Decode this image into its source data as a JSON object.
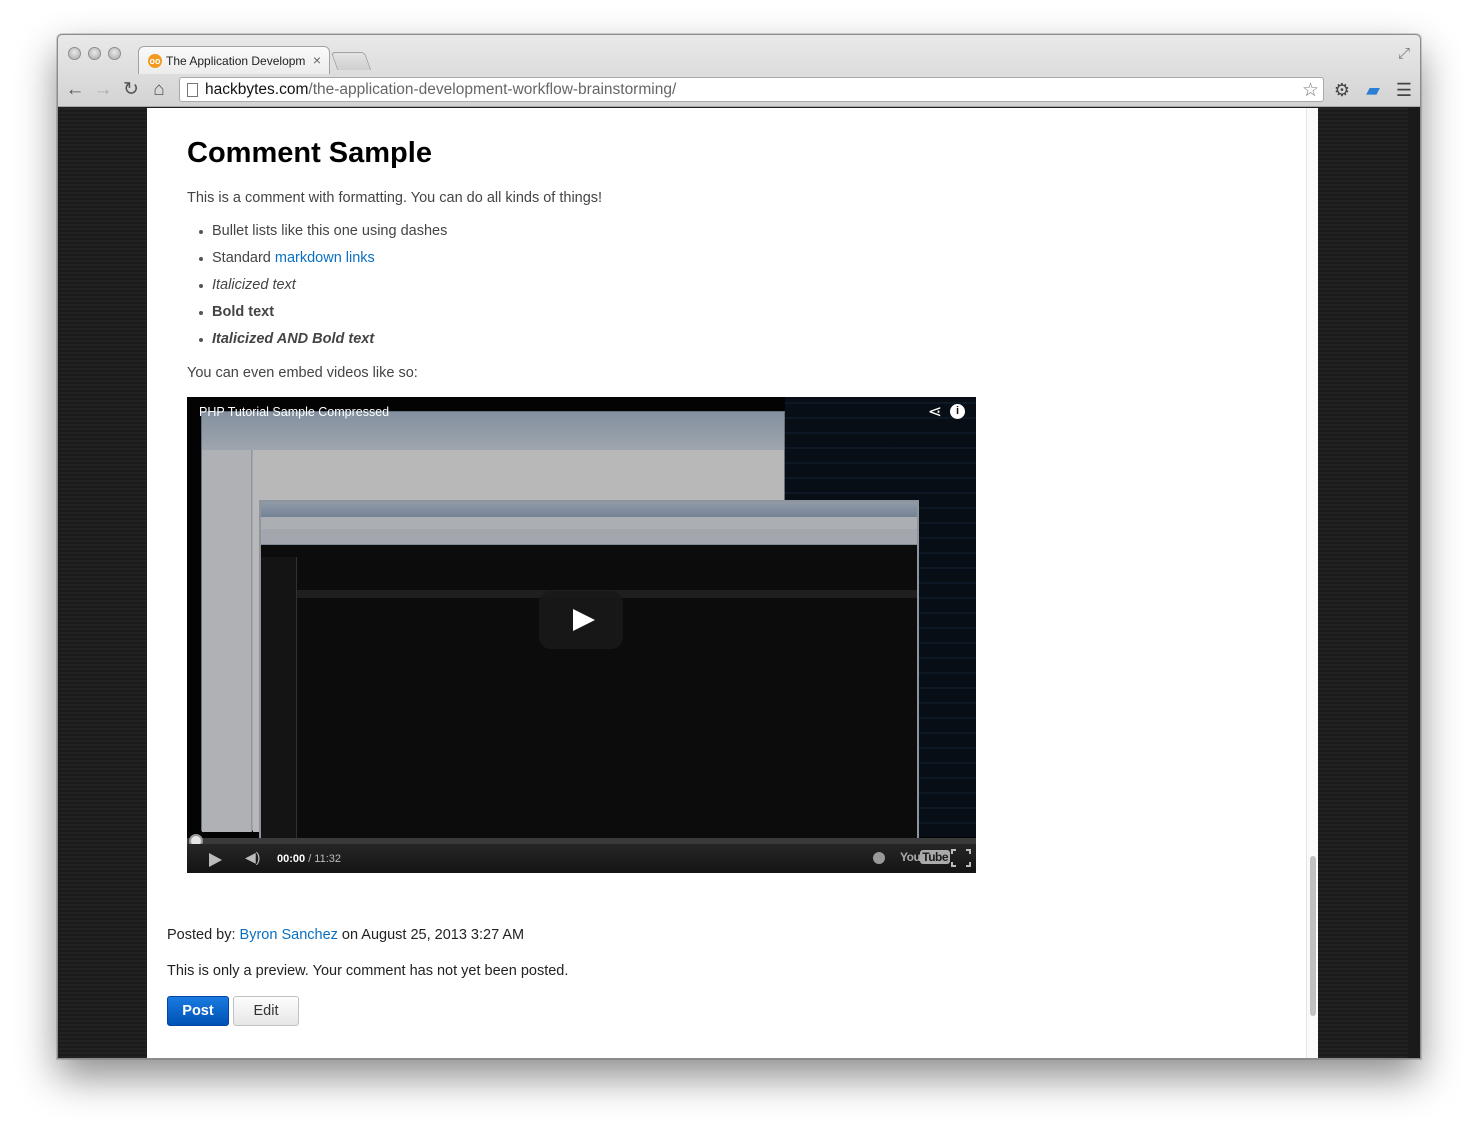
{
  "browser": {
    "tab_title": "The Application Developm",
    "tab_close": "×",
    "url_host": "hackbytes.com",
    "url_path": "/the-application-development-workflow-brainstorming/"
  },
  "comment": {
    "title": "Comment Sample",
    "intro": "This is a comment with formatting. You can do all kinds of things!",
    "list": {
      "item1": "Bullet lists like this one using dashes",
      "item2_prefix": "Standard ",
      "item2_link": "markdown links",
      "item3": "Italicized text",
      "item4": "Bold text",
      "item5": "Italicized AND Bold text"
    },
    "embed_text": "You can even embed videos like so:"
  },
  "video": {
    "title": "PHP Tutorial Sample Compressed",
    "time_current": "00:00",
    "time_total": " / 11:32",
    "logo_you": "You",
    "logo_tube": "Tube"
  },
  "post": {
    "posted_by_label": "Posted by: ",
    "author": "Byron Sanchez",
    "date": " on August 25, 2013 3:27 AM",
    "preview_note": "This is only a preview. Your comment has not yet been posted.",
    "post_button": "Post",
    "edit_button": "Edit"
  },
  "icons": {
    "back": "back-arrow-icon",
    "forward": "forward-arrow-icon",
    "reload": "reload-icon",
    "home": "home-icon",
    "bookmark": "star-icon",
    "settings": "gear-icon",
    "extension": "extension-icon",
    "menu": "hamburger-menu-icon"
  },
  "colors": {
    "link": "#0a6fc2",
    "post_button": "#0051b5"
  }
}
